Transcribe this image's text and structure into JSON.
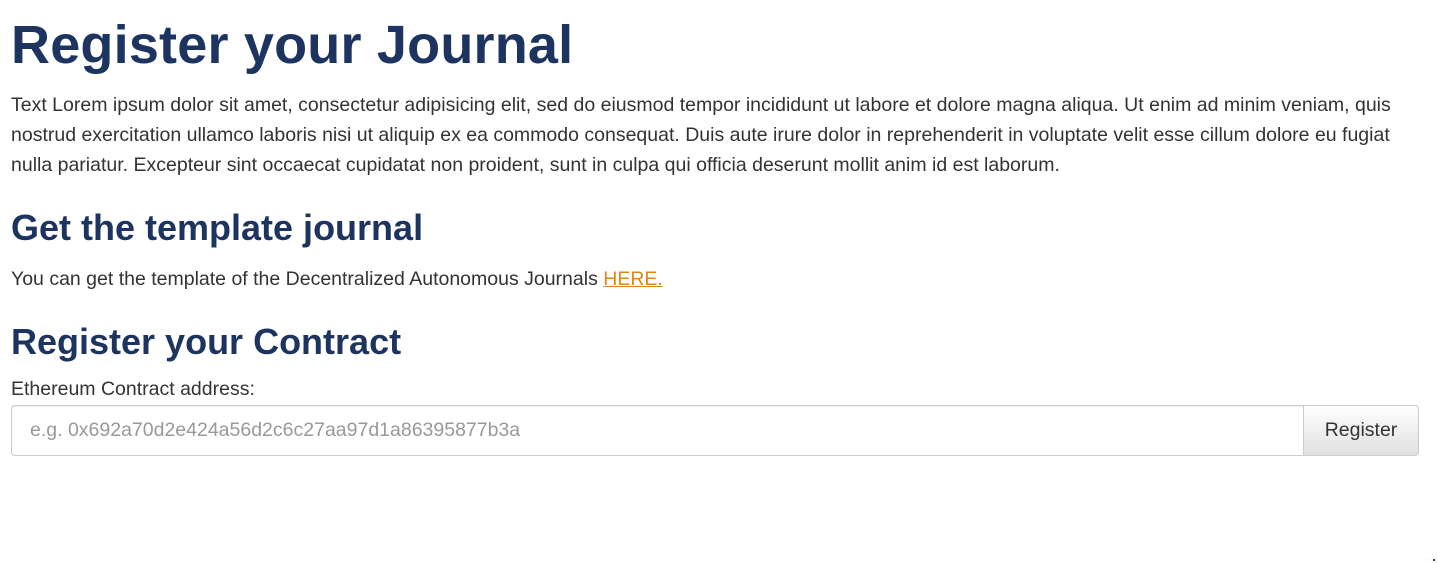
{
  "page": {
    "title": "Register your Journal",
    "intro": "Text Lorem ipsum dolor sit amet, consectetur adipisicing elit, sed do eiusmod tempor incididunt ut labore et dolore magna aliqua. Ut enim ad minim veniam, quis nostrud exercitation ullamco laboris nisi ut aliquip ex ea commodo consequat. Duis aute irure dolor in reprehenderit in voluptate velit esse cillum dolore eu fugiat nulla pariatur. Excepteur sint occaecat cupidatat non proident, sunt in culpa qui officia deserunt mollit anim id est laborum."
  },
  "template_section": {
    "heading": "Get the template journal",
    "text": "You can get the template of the Decentralized Autonomous Journals ",
    "link_label": "HERE."
  },
  "contract_section": {
    "heading": "Register your Contract",
    "field_label": "Ethereum Contract address:",
    "input_value": "",
    "input_placeholder": "e.g. 0x692a70d2e424a56d2c6c27aa97d1a86395877b3a",
    "register_label": "Register"
  },
  "colors": {
    "heading": "#1d3461",
    "link": "#d9891a",
    "text": "#333333"
  }
}
